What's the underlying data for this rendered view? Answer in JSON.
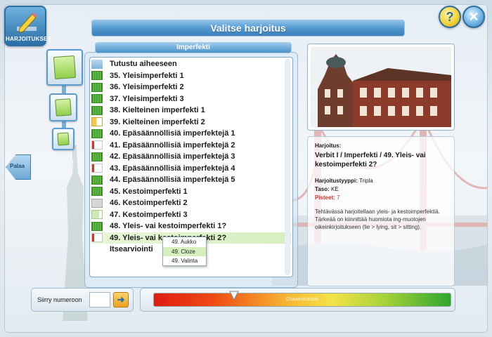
{
  "header": {
    "title": "Valitse harjoitus",
    "logo_label": "HARJOITUKSET"
  },
  "buttons": {
    "help": "?",
    "close": "✕",
    "back": "Palaa"
  },
  "list": {
    "header": "Imperfekti",
    "items": [
      {
        "label": "Tutustu aiheeseen",
        "bar": "intro"
      },
      {
        "label": "35. Yleisimperfekti 1",
        "bar": "full"
      },
      {
        "label": "36. Yleisimperfekti 2",
        "bar": "full"
      },
      {
        "label": "37. Yleisimperfekti 3",
        "bar": "full"
      },
      {
        "label": "38. Kielteinen imperfekti 1",
        "bar": "full"
      },
      {
        "label": "39. Kielteinen imperfekti 2",
        "bar": "yellow"
      },
      {
        "label": "40. Epäsäännöllisiä imperfektejä 1",
        "bar": "full"
      },
      {
        "label": "41. Epäsäännöllisiä imperfektejä 2",
        "bar": "redline"
      },
      {
        "label": "42. Epäsäännöllisiä imperfektejä 3",
        "bar": "full"
      },
      {
        "label": "43. Epäsäännöllisiä imperfektejä 4",
        "bar": "redline"
      },
      {
        "label": "44. Epäsäännöllisiä imperfektejä 5",
        "bar": "full"
      },
      {
        "label": "45. Kestoimperfekti 1",
        "bar": "full"
      },
      {
        "label": "46. Kestoimperfekti 2",
        "bar": "gray"
      },
      {
        "label": "47. Kestoimperfekti 3",
        "bar": "lightgreen"
      },
      {
        "label": "48. Yleis- vai kestoimperfekti 1?",
        "bar": "full"
      },
      {
        "label": "49. Yleis- vai kestoimperfekti 2?",
        "bar": "redline",
        "selected": true
      },
      {
        "label": "Itsearviointi",
        "bar": "none"
      }
    ]
  },
  "popup": {
    "items": [
      "49. Aukko",
      "49. Cloze",
      "49. Valinta"
    ],
    "hover_index": 1
  },
  "info": {
    "label": "Harjoitus:",
    "title": "Verbit I / Imperfekti / 49. Yleis- vai kestoimperfekti 2?",
    "type_key": "Harjoitustyyppi:",
    "type_value": "Tripla",
    "level_key": "Taso:",
    "level_value": "KE",
    "points_key": "Pisteet:",
    "points_value": "7",
    "description": "Tehtävässä harjoitellaan yleis- ja kestoimperfektiä. Tärkeää on kiinnittää huomiota ing-muotojen oikeinkirjoitukseen (lie > lying, sit > sitting)."
  },
  "goto": {
    "label": "Siirry numeroon",
    "value": "",
    "button": "➜"
  },
  "skill": {
    "label": "Osaamistasosi",
    "level_fraction": 0.27
  },
  "colors": {
    "accent": "#4f96cd",
    "selected": "#d5efbf",
    "points": "#d0342c"
  },
  "icons": {
    "logo": "pencil-icon",
    "back": "arrow-left-icon",
    "go": "arrow-right-icon"
  }
}
